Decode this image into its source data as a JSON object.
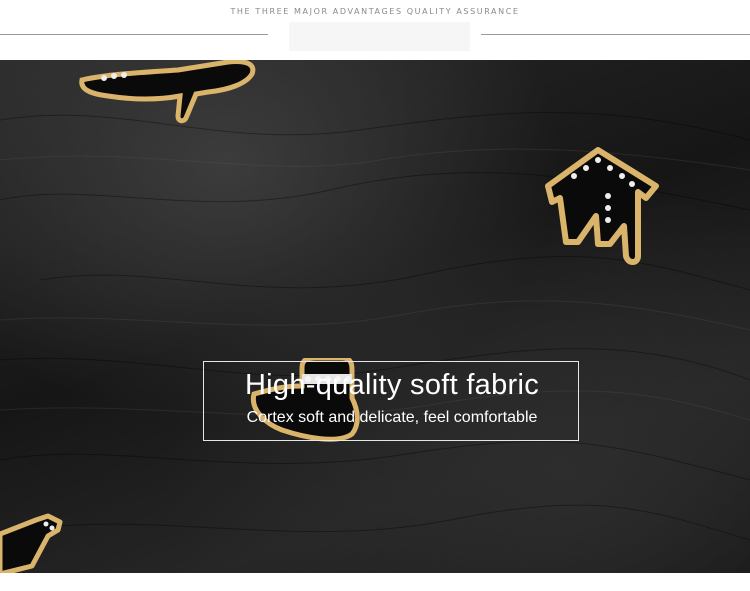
{
  "header": {
    "title": "THE THREE MAJOR ADVANTAGES QUALITY ASSURANCE"
  },
  "feature": {
    "title": "High-quality soft fabric",
    "subtitle": "Cortex soft and delicate, feel comfortable"
  },
  "colors": {
    "leather": "#1c1c1c",
    "gold": "#d9b46a",
    "enamel": "#0a0a0a",
    "frame": "#e6e6e6",
    "header_text": "#8a8a8a"
  },
  "charms": [
    "high-heel-shoe-charm",
    "house-charm",
    "hat-charm",
    "perfume-bottle-charm"
  ]
}
